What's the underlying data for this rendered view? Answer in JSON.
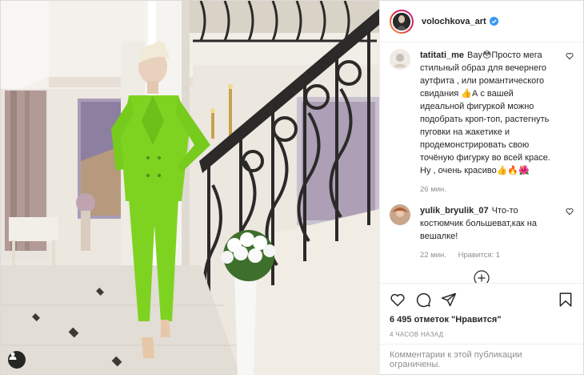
{
  "post": {
    "author": {
      "username": "volochkova_art",
      "verified": true
    },
    "comments": [
      {
        "username": "tatitati_me",
        "text": "Вау😳Просто мега стильный образ для вечернего аутфита , или романтического свидания 👍А с вашей идеальной фигуркой можно подобрать кроп-топ, растегнуть пуговки на жакетике и продемонстрировать свою точёную фигурку во всей красе. Ну , очень красиво👍🔥🌺",
        "time": "26 мин.",
        "likes": ""
      },
      {
        "username": "yulik_bryulik_07",
        "text": "Что-то костюмчик большеват,как на вешалке!",
        "time": "22 мин.",
        "likes": "Нравится: 1"
      }
    ],
    "likes_text": "6 495 отметок \"Нравится\"",
    "posted_ago": "4 часов назад",
    "comments_restricted": "Комментарии к этой публикации ограничены."
  },
  "icons": {
    "like": "heart-icon",
    "comment": "comment-icon",
    "share": "share-icon",
    "save": "bookmark-icon",
    "load_more": "plus-circle-icon",
    "tag": "user-tag-icon",
    "verified": "verified-badge-icon"
  },
  "colors": {
    "suit": "#7ed321",
    "verified": "#3897f0",
    "text": "#262626",
    "muted": "#8e8e8e"
  }
}
